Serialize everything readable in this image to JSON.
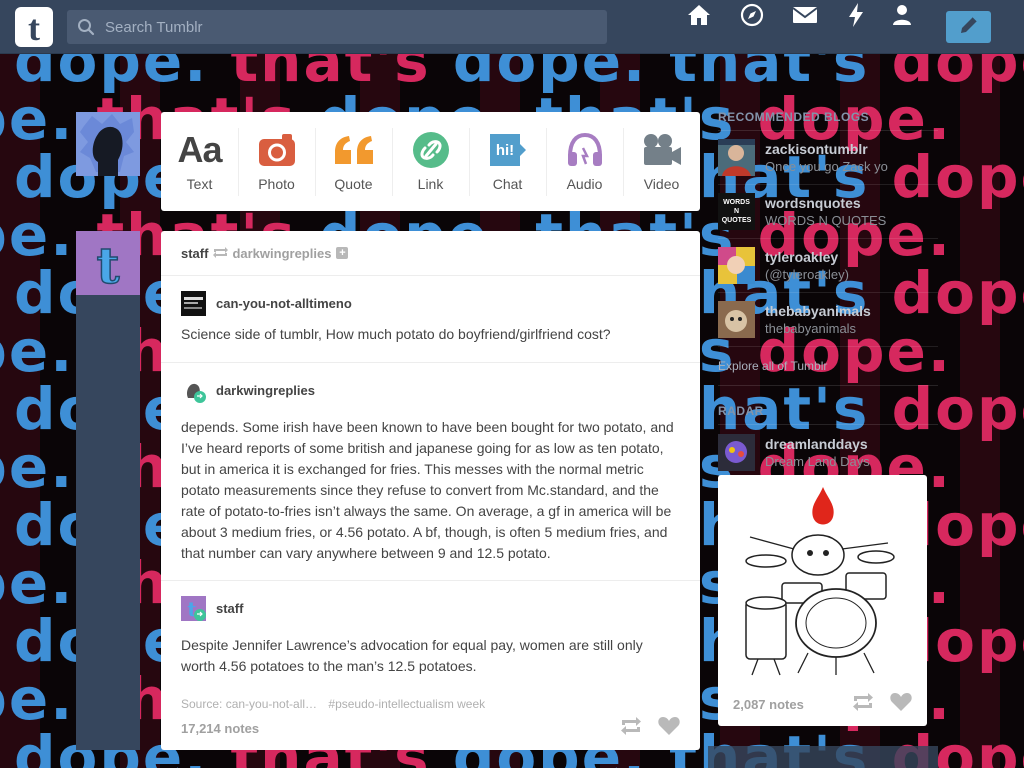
{
  "background": {
    "phrase": "dope. that's dope. that's dope.",
    "colors": {
      "blue": "#3e8fd6",
      "pink": "#d6285e"
    }
  },
  "header": {
    "logo_letter": "t",
    "search_placeholder": "Search Tumblr",
    "nav": [
      "home-icon",
      "compass-icon",
      "mail-icon",
      "lightning-icon",
      "account-icon"
    ],
    "compose": "pencil-icon",
    "colors": {
      "bar": "#36465d",
      "compose": "#529ecc"
    }
  },
  "post_types": [
    {
      "label": "Text",
      "glyph": "Aa",
      "color": "#444444"
    },
    {
      "label": "Photo",
      "color": "#d95e40"
    },
    {
      "label": "Quote",
      "glyph": "““",
      "color": "#f2992e"
    },
    {
      "label": "Link",
      "color": "#56bc8a"
    },
    {
      "label": "Chat",
      "glyph": "hi!",
      "color": "#529ecc"
    },
    {
      "label": "Audio",
      "color": "#a77dc2"
    },
    {
      "label": "Video",
      "color": "#748089"
    }
  ],
  "post": {
    "owner": "staff",
    "reblogged_from": "darkwingreplies",
    "entries": [
      {
        "author": "can-you-not-alltimeno",
        "text": "Science side of tumblr, How much potato do boyfriend/girlfriend cost?"
      },
      {
        "author": "darkwingreplies",
        "text": "depends. Some irish have been known to have been bought for two potato, and I’ve heard reports of some british and japanese going for as low as ten potato, but in america it is exchanged for fries. This messes with the normal metric potato measurements since they refuse to convert from Mc.standard, and the rate of potato-to-fries isn’t always the same. On average, a gf in america will be about 3 medium fries, or 4.56 potato. A bf, though, is often 5 medium fries, and that number can vary anywhere between 9 and 12.5 potato."
      },
      {
        "author": "staff",
        "text": "Despite Jennifer Lawrence’s advocation for equal pay, women are still only worth 4.56 potatoes to the man’s 12.5 potatoes."
      }
    ],
    "source": "Source: can-you-not-all…",
    "tag": "#pseudo-intellectualism week",
    "notes": "17,214 notes"
  },
  "sidebar": {
    "recommended_heading": "RECOMMENDED BLOGS",
    "blogs": [
      {
        "name": "zackisontumblr",
        "subtitle": "Once you go Zack yo"
      },
      {
        "name": "wordsnquotes",
        "subtitle": "WORDS N QUOTES",
        "thumb_text": "WORDS N QUOTES"
      },
      {
        "name": "tyleroakley",
        "subtitle": "(@tyleroakley)"
      },
      {
        "name": "thebabyanimals",
        "subtitle": "thebabyanimals"
      }
    ],
    "explore": "Explore all of Tumblr",
    "radar_heading": "RADAR",
    "radar": {
      "name": "dreamlanddays",
      "subtitle": "Dream Land Days",
      "notes": "2,087 notes"
    }
  }
}
